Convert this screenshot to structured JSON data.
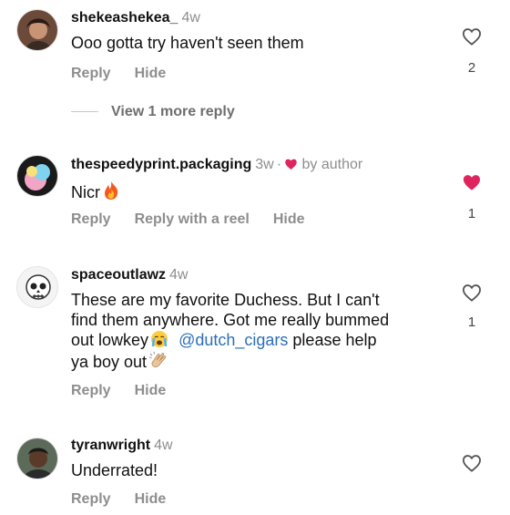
{
  "comments": [
    {
      "username": "shekeashekea_",
      "time": "4w",
      "text": "Ooo gotta try haven't seen them",
      "actions": [
        "Reply",
        "Hide"
      ],
      "likes": "2",
      "liked": false
    },
    {
      "username": "thespeedyprint.packaging",
      "time": "3w",
      "dot": "·",
      "by_author": "by author",
      "text": "Nicr",
      "emoji": "fire-emoji",
      "actions": [
        "Reply",
        "Reply with a reel",
        "Hide"
      ],
      "likes": "1",
      "liked": true
    },
    {
      "username": "spaceoutlawz",
      "time": "4w",
      "text_parts": [
        "These are my favorite Duchess. But I can't",
        "find them anywhere. Got me really bummed",
        "out lowkey",
        "@dutch_cigars",
        "please help",
        "ya boy out"
      ],
      "emojis": [
        "crying-emoji",
        "clapping-hands-emoji"
      ],
      "actions": [
        "Reply",
        "Hide"
      ],
      "likes": "1",
      "liked": false
    },
    {
      "username": "tyranwright",
      "time": "4w",
      "text": "Underrated!",
      "actions": [
        "Reply",
        "Hide"
      ],
      "liked": false
    }
  ],
  "view_more_replies": "View 1 more reply",
  "colors": {
    "heart_liked": "#e0245e",
    "mention": "#2b6fb8",
    "muted": "#8e8e8e"
  }
}
